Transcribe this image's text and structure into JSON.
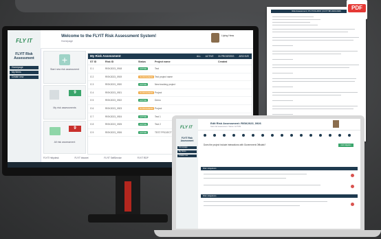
{
  "monitor": {
    "sidebar": {
      "logo_text": "FLY IT",
      "brand": "FLYIT Risk Assessment",
      "nav": [
        "Homepage",
        "My Items",
        "Create new"
      ]
    },
    "header": {
      "title": "Welcome to the FLYIT Risk Assessment System!",
      "subtitle": "Homepage",
      "user": "Liping Hess"
    },
    "cards": [
      {
        "label": "Start new risk assessment",
        "icon": "plus-icon"
      },
      {
        "label": "My risk assessments",
        "count": "9",
        "badge_color": "#3aa56b",
        "icon": "doc-icon"
      },
      {
        "label": "All risk assessment",
        "count": "9",
        "badge_color": "#c9302c",
        "icon": "folder-icon"
      }
    ],
    "table": {
      "title": "My Risk Assessment",
      "filters": [
        "ALL",
        "ACTIVE",
        "IN PROGRESS",
        "ARCHIVE"
      ],
      "columns": [
        "ST ID",
        "Risk ID",
        "Status",
        "Project name",
        "Created"
      ],
      "rows": [
        {
          "st": "G 1",
          "risk": "RISK2023_0918",
          "status": "ACTIVE",
          "status_color": "#3aa56b",
          "project": "Test"
        },
        {
          "st": "G 2",
          "risk": "RISK2023_0919",
          "status": "IN PROGRESS",
          "status_color": "#f0ad4e",
          "project": "Test project name"
        },
        {
          "st": "G 3",
          "risk": "RISK2023_0920",
          "status": "ACTIVE",
          "status_color": "#3aa56b",
          "project": "New tracking project"
        },
        {
          "st": "G 4",
          "risk": "RISK2023_0921",
          "status": "IN PROGRESS",
          "status_color": "#f0ad4e",
          "project": "Project"
        },
        {
          "st": "G 5",
          "risk": "RISK2023_0922",
          "status": "ACTIVE",
          "status_color": "#3aa56b",
          "project": "Demo"
        },
        {
          "st": "G 6",
          "risk": "RISK2023_0923",
          "status": "IN PROGRESS",
          "status_color": "#f0ad4e",
          "project": "Project"
        },
        {
          "st": "G 7",
          "risk": "RISK2023_0924",
          "status": "ACTIVE",
          "status_color": "#3aa56b",
          "project": "Test 1"
        },
        {
          "st": "G 8",
          "risk": "RISK2023_0925",
          "status": "ACTIVE",
          "status_color": "#3aa56b",
          "project": "Test 2"
        },
        {
          "st": "G 9",
          "risk": "RISK2023_0926",
          "status": "ACTIVE",
          "status_color": "#3aa56b",
          "project": "TEST PROJECT"
        }
      ]
    },
    "shortcuts": [
      "FLYIT Helpdesk",
      "FLYIT Intranet",
      "FLYIT SelfService",
      "FLYIT RDP"
    ]
  },
  "laptop": {
    "sidebar": {
      "logo_text": "FLY IT",
      "brand": "FLYIT Risk Assessment",
      "nav": [
        "Homepage",
        "My Items",
        "Create new"
      ]
    },
    "header": {
      "title": "Edit Risk Assessment: RISK2023_0926",
      "subtitle": "Start risk assessment: Status: ACTIVE"
    },
    "question": "Does the project include interactions with Government Officials?",
    "sections": [
      "Risk mitigations",
      "Risk mitigations"
    ],
    "buttons": {
      "add": "Add mitigation"
    }
  },
  "paper": {
    "title": "Risk Assessment | PC-TOOL-BOX | FLYIT BP-2023-0926",
    "pdf_label": "PDF"
  }
}
